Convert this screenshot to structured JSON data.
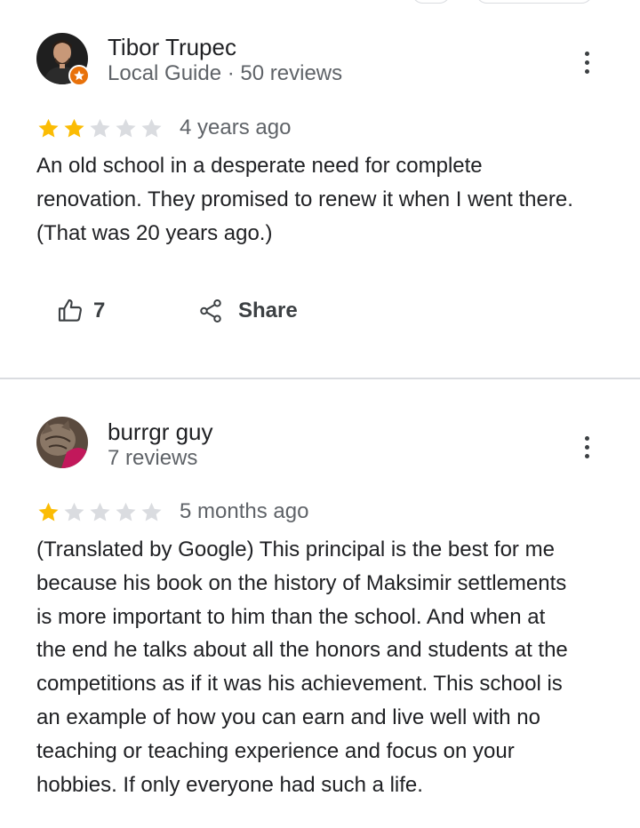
{
  "colors": {
    "star_filled": "#fbbc04",
    "star_empty": "#dadce0",
    "secondary_text": "#5f6368",
    "local_guide_badge": "#e8710a"
  },
  "reviews": [
    {
      "author": "Tibor Trupec",
      "meta": "Local Guide · 50 reviews",
      "local_guide": true,
      "rating": 2,
      "max_rating": 5,
      "time": "4 years ago",
      "text": "An old school in a desperate need for complete\nrenovation.  They promised to renew it when I went there.\n(That was 20 years ago.)",
      "likes": "7",
      "share_label": "Share",
      "more_icon": "more-vert-icon",
      "like_icon": "thumb-up-icon",
      "share_icon": "share-icon"
    },
    {
      "author": "burrgr guy",
      "meta": "7 reviews",
      "local_guide": false,
      "rating": 1,
      "max_rating": 5,
      "time": "5 months ago",
      "text": "(Translated by Google) This principal is the best for me\nbecause his book on the history of Maksimir settlements\nis more important to him than the school. And when at\nthe end he talks about all the honors and students at the\ncompetitions as if it was his achievement. This school is\nan example of how you can earn and live well with no\nteaching or teaching experience and focus on your\nhobbies. If only everyone had such a life.",
      "more_icon": "more-vert-icon"
    }
  ]
}
